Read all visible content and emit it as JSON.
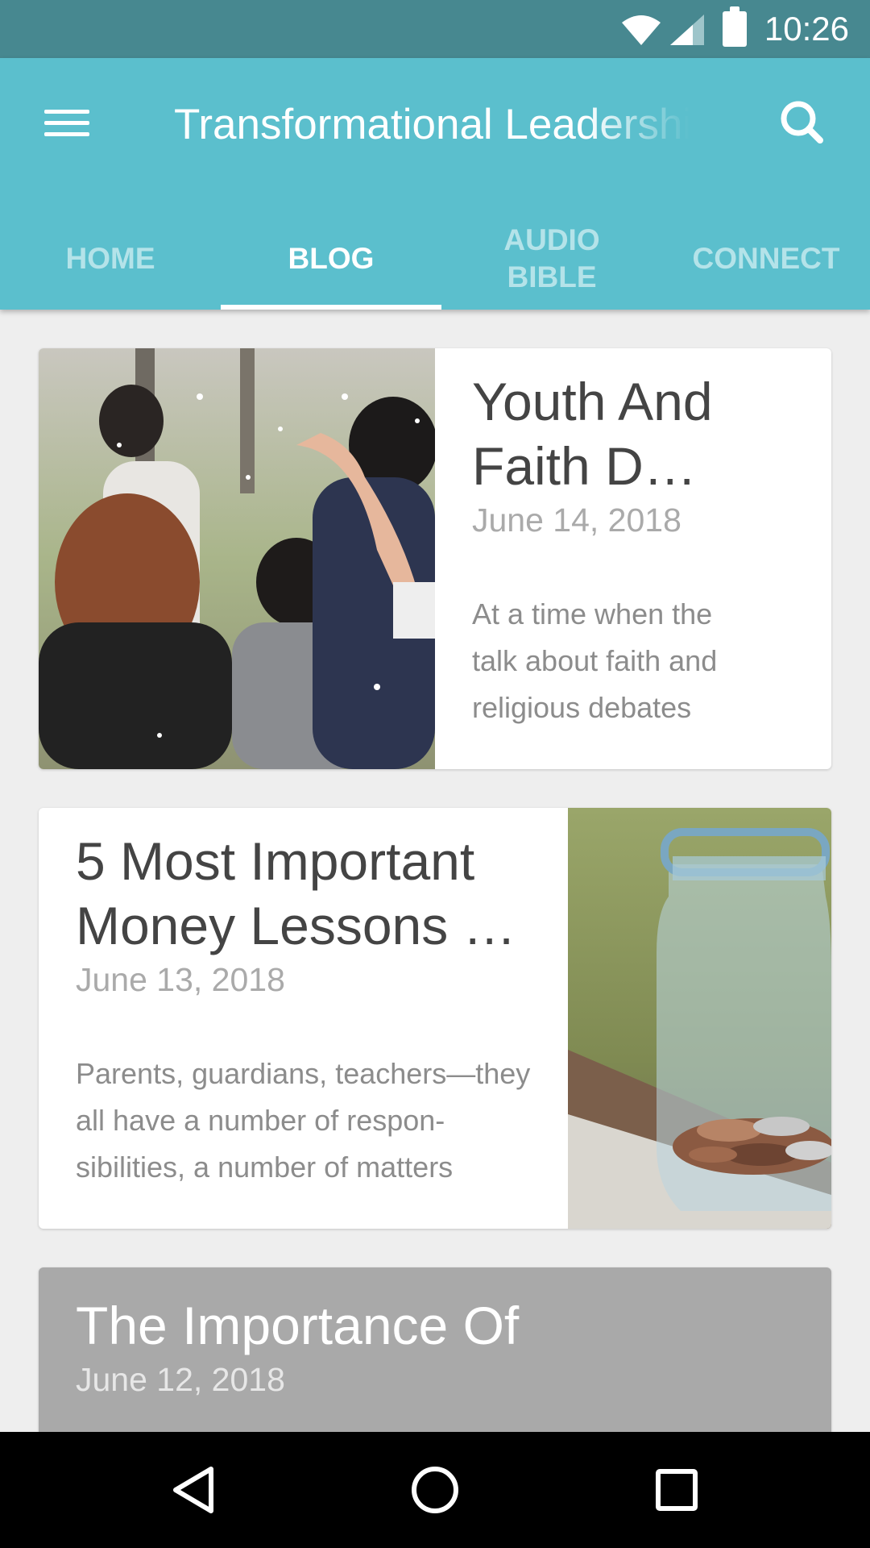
{
  "status_bar": {
    "time": "10:26"
  },
  "app_bar": {
    "title": "Transformational Leadership",
    "menu_icon": "hamburger-menu-icon",
    "search_icon": "search-icon"
  },
  "tabs": [
    {
      "label": "HOME",
      "active": false
    },
    {
      "label": "BLOG",
      "active": true
    },
    {
      "label": "AUDIO BIBLE",
      "active": false
    },
    {
      "label": "CONNECT",
      "active": false
    }
  ],
  "posts": [
    {
      "title": "Youth And Faith D…",
      "date": "June 14, 2018",
      "excerpt": "At a time when the talk about faith and religious debates",
      "image": "crowd-of-young-people-photo"
    },
    {
      "title": "5 Most Important Money Lessons …",
      "date": "June 13, 2018",
      "excerpt": "Parents, guardians, teachers—they all have a number of respon-sibilities, a number of matters",
      "image": "coin-jar-photo"
    },
    {
      "title": "The Importance Of",
      "date": "June 12, 2018"
    }
  ],
  "nav_bar": {
    "back_icon": "back-triangle-icon",
    "home_icon": "home-circle-icon",
    "recents_icon": "recents-square-icon"
  },
  "colors": {
    "status_bar": "#478890",
    "app_bar": "#5bbfcd",
    "tab_inactive": "#b4e3e9",
    "background": "#eeeeee"
  }
}
